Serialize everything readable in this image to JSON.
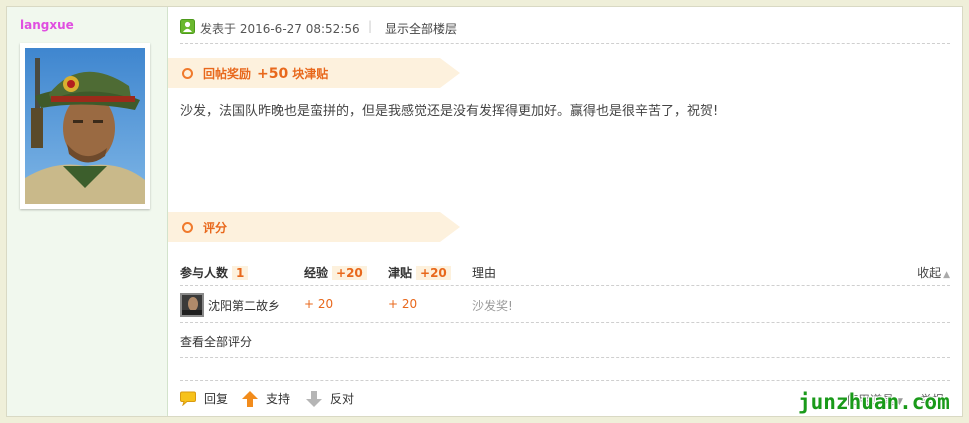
{
  "user": {
    "username": "langxue"
  },
  "post_header": {
    "posted_at": "发表于 2016-6-27 08:52:56",
    "separator": "|",
    "show_all_floors": "显示全部楼层"
  },
  "reward_banner": {
    "label": "回帖奖励",
    "amount": "+50",
    "unit": "块津贴"
  },
  "post_body": {
    "text": "沙发，法国队昨晚也是蛮拼的，但是我感觉还是没有发挥得更加好。赢得也是很辛苦了，祝贺!"
  },
  "rating_banner": {
    "label": "评分"
  },
  "rating_table": {
    "participants_label": "参与人数",
    "participants_count": "1",
    "exp_label": "经验",
    "exp_total": "+20",
    "tie_label": "津贴",
    "tie_total": "+20",
    "reason_label": "理由",
    "collapse_label": "收起",
    "rows": [
      {
        "rater": "沈阳第二故乡",
        "exp": "+ 20",
        "tie": "+ 20",
        "reason": "沙发奖!"
      }
    ]
  },
  "view_all_ratings": "查看全部评分",
  "actions": {
    "reply": "回复",
    "support": "支持",
    "oppose": "反对",
    "use_tools": "使用道具",
    "report": "举报"
  },
  "watermark": "junzhuan.com",
  "colors": {
    "accent_orange": "#e8681c",
    "username_pink": "#e04fe0",
    "banner_bg": "#fdf1dd",
    "sidebar_bg": "#f1f8ee",
    "watermark_green": "#1a9a1a"
  },
  "icons": {
    "online": "user-online-icon",
    "reply": "speech-bubble-icon",
    "support": "arrow-up-icon",
    "oppose": "arrow-down-icon"
  }
}
